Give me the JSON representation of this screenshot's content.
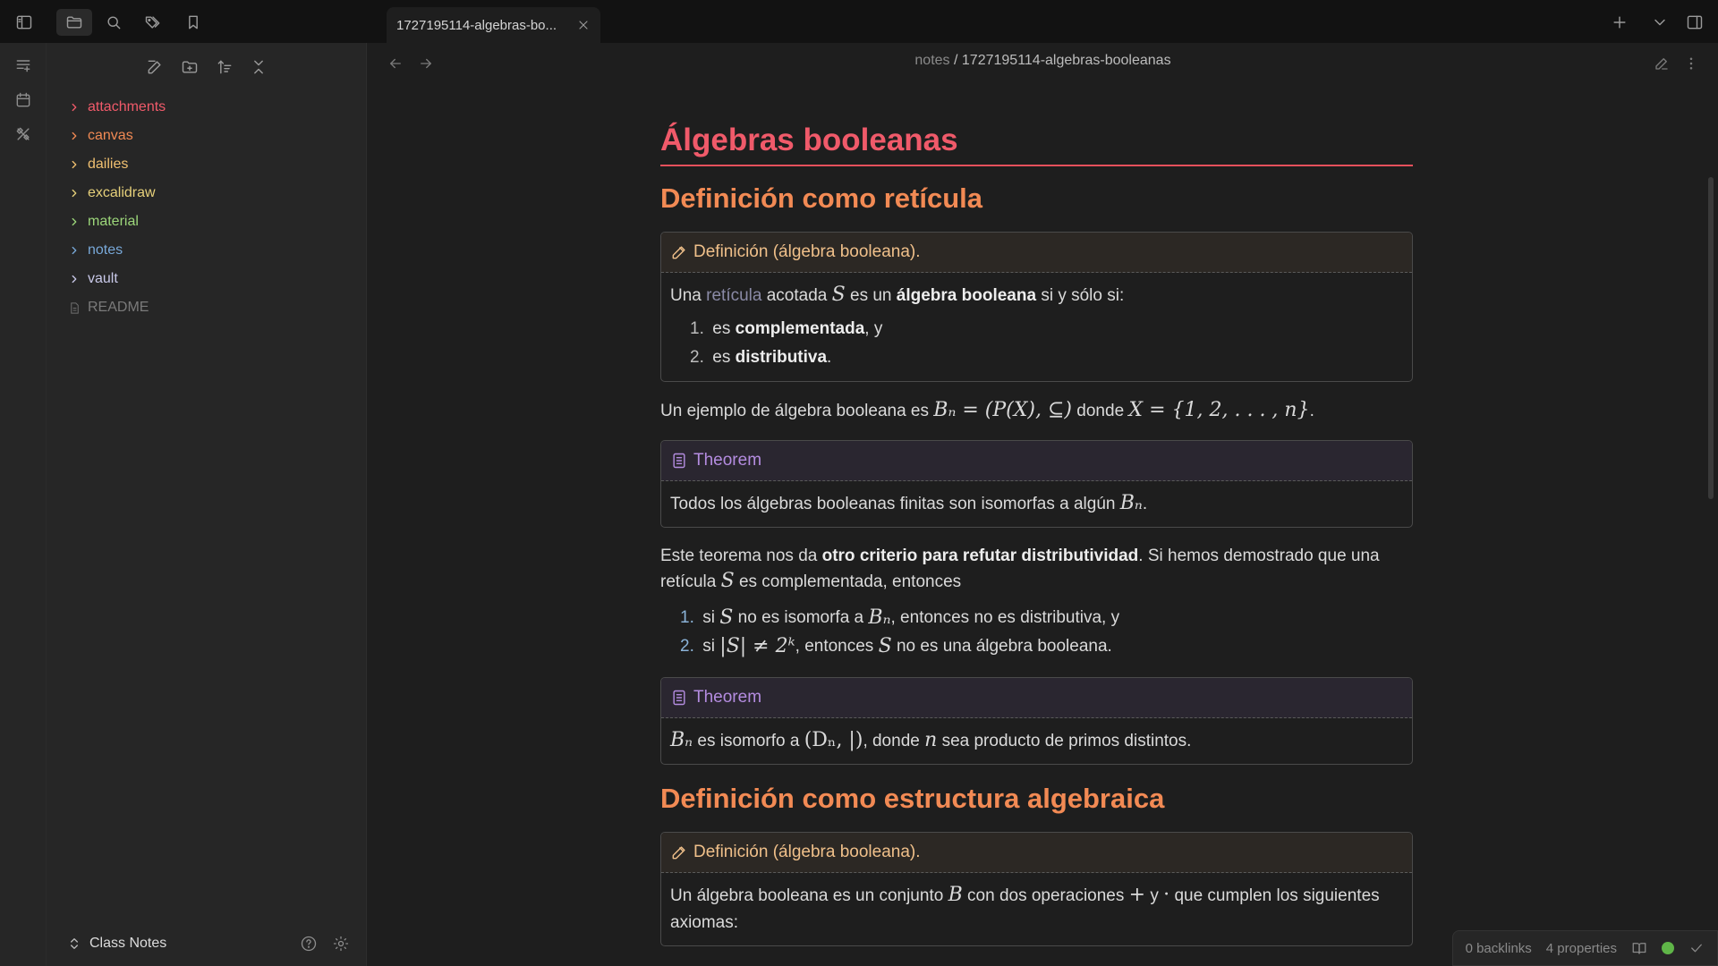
{
  "app": {
    "accent": "#f05a6a"
  },
  "tab": {
    "title": "1727195114-algebras-bo..."
  },
  "breadcrumb": {
    "folder": "notes",
    "separator": "/",
    "file": "1727195114-algebras-booleanas"
  },
  "sidebar": {
    "items": [
      {
        "label": "attachments",
        "color": "#f05a6a",
        "type": "folder"
      },
      {
        "label": "canvas",
        "color": "#f28a54",
        "type": "folder"
      },
      {
        "label": "dailies",
        "color": "#f0c070",
        "type": "folder"
      },
      {
        "label": "excalidraw",
        "color": "#e6d07a",
        "type": "folder"
      },
      {
        "label": "material",
        "color": "#9cd67a",
        "type": "folder"
      },
      {
        "label": "notes",
        "color": "#78a8d8",
        "type": "folder"
      },
      {
        "label": "vault",
        "color": "#c8c8e8",
        "type": "folder"
      },
      {
        "label": "README",
        "color": "#7a7a7a",
        "type": "file"
      }
    ],
    "vault_name": "Class Notes"
  },
  "note": {
    "title": "Álgebras booleanas",
    "h2_lattice": "Definición como retícula",
    "callout_def1": {
      "title": "Definición (álgebra booleana).",
      "pre": "Una",
      "link": "retícula",
      "mid1": "acotada",
      "var": "S",
      "mid2": "es un",
      "bold": "álgebra booleana",
      "post": "si y sólo si:",
      "items": [
        {
          "num": "1.",
          "pre": "es",
          "bold": "complementada",
          "post": ", y"
        },
        {
          "num": "2.",
          "pre": "es",
          "bold": "distributiva",
          "post": "."
        }
      ]
    },
    "example": {
      "pre": "Un ejemplo de álgebra booleana es",
      "math1": "Bₙ = (P(X), ⊆)",
      "mid": "donde",
      "math2": "X = {1, 2, . . . , n}",
      "post": "."
    },
    "theorem1": {
      "title": "Theorem",
      "text": "Todos los álgebras booleanas finitas son isomorfas a algún",
      "math": "Bₙ",
      "post": "."
    },
    "para2": {
      "pre": "Este teorema nos da",
      "bold": "otro criterio para refutar distributividad",
      "mid": ". Si hemos demostrado que una retícula",
      "var": "S",
      "post": "es complementada, entonces"
    },
    "criteria": [
      {
        "num": "1.",
        "pre": "si",
        "m1": "S",
        "mid": "no es isomorfa a",
        "m2": "Bₙ",
        "post": ", entonces no es distributiva, y"
      },
      {
        "num": "2.",
        "pre": "si",
        "m1": "|S| ≠ 2ᵏ",
        "mid": ", entonces",
        "m2": "S",
        "post": "no es una álgebra booleana."
      }
    ],
    "theorem2": {
      "title": "Theorem",
      "math1": "Bₙ",
      "mid": "es isomorfo a",
      "math2": "(Dₙ, |)",
      "mid2": ", donde",
      "math3": "n",
      "post": "sea producto de primos distintos."
    },
    "h2_algebraic": "Definición como estructura algebraica",
    "callout_def2": {
      "title": "Definición (álgebra booleana).",
      "pre": "Un álgebra booleana es un conjunto",
      "var": "B",
      "mid": "con dos operaciones",
      "op1": "+",
      "y": "y",
      "op2": "·",
      "post": "que cumplen los siguientes axiomas:"
    }
  },
  "status": {
    "backlinks": "0 backlinks",
    "properties": "4 properties",
    "sync_color": "#5fb548"
  }
}
